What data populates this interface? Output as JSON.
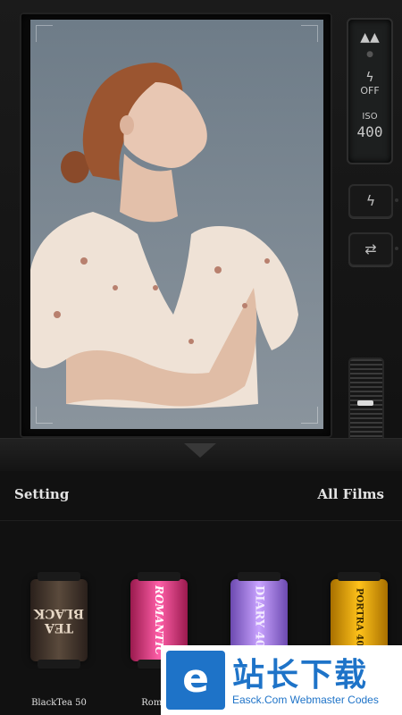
{
  "lcd": {
    "mode_icon": "mountain-icon",
    "flash_value": "OFF",
    "iso_label": "ISO",
    "iso_value": "400"
  },
  "buttons": {
    "flash_icon": "lightning-icon",
    "switch_icon": "camera-switch-icon"
  },
  "header": {
    "setting_label": "Setting",
    "all_films_label": "All Films"
  },
  "films": [
    {
      "name": "BlackTea 50",
      "label_line1": "TEA",
      "label_line2": "BLACK"
    },
    {
      "name": "Romant",
      "label": "Romantic"
    },
    {
      "name": "",
      "label": "DIARY 400"
    },
    {
      "name": "",
      "label": "PORTRA 400"
    }
  ],
  "watermark": {
    "logo_letter": "e",
    "title": "站长下载",
    "subtitle": "Easck.Com Webmaster Codes"
  }
}
